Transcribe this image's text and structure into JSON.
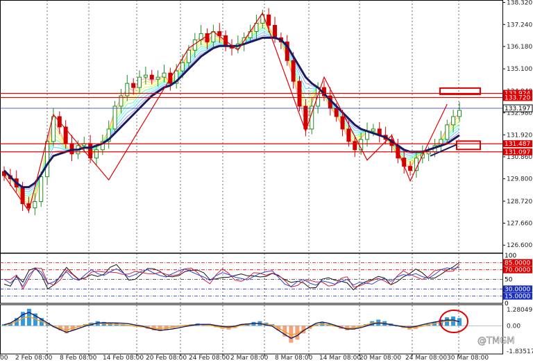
{
  "chart_data": [
    {
      "type": "candlestick",
      "title": "",
      "price_axis_ticks": [
        126.6,
        127.66,
        128.72,
        129.8,
        130.86,
        131.92,
        132.98,
        134.04,
        135.1,
        136.18,
        137.24,
        138.3
      ],
      "price_axis_labels": [
        "126.600",
        "127.660",
        "128.720",
        "129.800",
        "130.860",
        "131.920",
        "132.980",
        "134.040",
        "135.100",
        "136.180",
        "137.240",
        "138.320"
      ],
      "ylim": [
        126.24,
        138.42
      ],
      "x_dates": [
        "2 Feb 08:00",
        "8 Feb 08:00",
        "14 Feb 08:00",
        "20 Feb 08:00",
        "24 Feb 08:00",
        "2 Mar 08:00",
        "8 Mar 08:00",
        "14 Mar 08:00",
        "20 Mar 08:00",
        "24 Mar 08:00",
        "30 Mar 08:00"
      ],
      "x_leading_label": "00",
      "price_path": [
        129.95,
        129.8,
        129.4,
        128.6,
        128.4,
        128.7,
        129.9,
        131.6,
        132.8,
        132.3,
        131.5,
        131.0,
        131.4,
        131.5,
        130.8,
        131.2,
        131.6,
        132.2,
        133.3,
        133.8,
        134.4,
        134.2,
        134.7,
        134.8,
        134.6,
        134.7,
        134.9,
        134.4,
        135.0,
        135.4,
        136.0,
        136.5,
        136.8,
        136.4,
        136.9,
        136.7,
        136.2,
        136.1,
        136.3,
        136.6,
        136.9,
        137.3,
        137.7,
        137.2,
        136.6,
        136.4,
        135.5,
        134.5,
        133.3,
        132.2,
        133.3,
        134.2,
        133.8,
        133.2,
        132.8,
        132.2,
        131.6,
        131.2,
        131.7,
        132.1,
        132.2,
        131.9,
        131.7,
        131.4,
        130.8,
        130.4,
        130.2,
        130.8,
        131.0,
        131.1,
        131.4,
        131.7,
        132.4,
        132.8,
        133.1
      ],
      "ma_bold": [
        130.2,
        129.9,
        129.6,
        129.4,
        129.4,
        129.6,
        130.0,
        130.5,
        130.9,
        131.0,
        131.1,
        131.2,
        131.2,
        131.3,
        131.3,
        131.4,
        131.5,
        131.7,
        132.0,
        132.3,
        132.6,
        132.9,
        133.2,
        133.5,
        133.8,
        134.0,
        134.2,
        134.3,
        134.5,
        134.8,
        135.1,
        135.4,
        135.7,
        135.9,
        136.1,
        136.2,
        136.2,
        136.2,
        136.2,
        136.3,
        136.4,
        136.5,
        136.6,
        136.6,
        136.6,
        136.5,
        136.2,
        135.7,
        135.2,
        134.7,
        134.4,
        134.2,
        133.9,
        133.6,
        133.3,
        133.0,
        132.7,
        132.4,
        132.2,
        132.1,
        132.0,
        131.9,
        131.8,
        131.6,
        131.4,
        131.2,
        131.1,
        131.1,
        131.1,
        131.2,
        131.3,
        131.4,
        131.5,
        131.7,
        131.9
      ],
      "zigzag": [
        [
          0,
          129.95
        ],
        [
          4,
          128.25
        ],
        [
          8,
          132.9
        ],
        [
          17,
          129.75
        ],
        [
          30,
          136.1
        ],
        [
          34,
          136.9
        ],
        [
          38,
          136.0
        ],
        [
          42,
          137.8
        ],
        [
          49,
          132.1
        ],
        [
          52,
          134.7
        ],
        [
          59,
          130.7
        ],
        [
          63,
          131.9
        ],
        [
          66,
          129.7
        ],
        [
          72,
          133.4
        ]
      ],
      "horizontal_levels": [
        {
          "label": "133.924",
          "value": 133.92,
          "color": "#e00000"
        },
        {
          "label": "133.720",
          "value": 133.72,
          "color": "#e00000"
        },
        {
          "label": "133.197",
          "value": 133.2,
          "color": "#1c2fbf"
        },
        {
          "label": "131.487",
          "value": 131.49,
          "color": "#e00000"
        },
        {
          "label": "131.097",
          "value": 131.1,
          "color": "#e00000"
        }
      ],
      "current_price_label": "133.197",
      "colors": {
        "bull": "#1e8f1e",
        "bear": "#d00000",
        "ma": "#1a1a60",
        "zigzag": "#e00000"
      }
    },
    {
      "type": "line",
      "title": "",
      "yaxis_labels": [
        "100",
        "85.0000",
        "70.0000",
        "50",
        "30.0000",
        "15.0000",
        "0"
      ],
      "levels": [
        100,
        85,
        70,
        50,
        30,
        15,
        0
      ],
      "ylim": [
        0,
        100
      ],
      "series_values": [
        50,
        42,
        55,
        35,
        60,
        72,
        65,
        40,
        45,
        55,
        66,
        52,
        48,
        60,
        70,
        62,
        58,
        66,
        72,
        64,
        55,
        60,
        67,
        70,
        63,
        58,
        55,
        62,
        68,
        72,
        66,
        60,
        55,
        48,
        58,
        64,
        60,
        55,
        52,
        49,
        56,
        62,
        66,
        68,
        54,
        40,
        35,
        45,
        50,
        42,
        38,
        47,
        44,
        40,
        45,
        50,
        38,
        44,
        42,
        40,
        48,
        52,
        46,
        55,
        60,
        58,
        62,
        56,
        52,
        60,
        70,
        74,
        72,
        76
      ]
    },
    {
      "type": "bar",
      "title": "",
      "yaxis_labels": [
        "1.28049",
        "0.00",
        "-1.83517"
      ],
      "ylim": [
        -1.83517,
        1.28049
      ],
      "values": [
        0.1,
        0.2,
        0.5,
        0.9,
        1.1,
        0.8,
        0.5,
        0.2,
        -0.1,
        -0.3,
        -0.5,
        -0.3,
        -0.1,
        0.1,
        0.2,
        0.3,
        0.25,
        0.2,
        0.15,
        0.1,
        0.05,
        -0.05,
        -0.1,
        -0.2,
        -0.3,
        -0.35,
        -0.25,
        -0.15,
        -0.05,
        0.05,
        0.1,
        0.15,
        0.1,
        0.05,
        -0.1,
        -0.2,
        -0.25,
        -0.15,
        0.05,
        0.15,
        0.25,
        0.3,
        0.2,
        0.1,
        -0.3,
        -0.7,
        -1.1,
        -0.9,
        -0.5,
        -0.2,
        0.1,
        0.2,
        0.1,
        -0.05,
        -0.2,
        -0.3,
        -0.25,
        -0.1,
        0.1,
        0.3,
        0.4,
        0.3,
        0.15,
        0.0,
        -0.15,
        -0.25,
        -0.2,
        -0.05,
        0.1,
        0.25,
        0.4,
        0.55,
        0.6,
        0.5
      ]
    }
  ],
  "watermark": "@TMGM"
}
